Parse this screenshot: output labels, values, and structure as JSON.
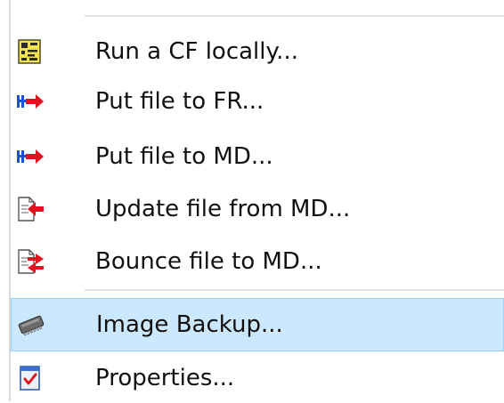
{
  "menu": {
    "items": [
      {
        "label": "Run a CF locally...",
        "icon": "run-cf-icon"
      },
      {
        "label": "Put file to FR...",
        "icon": "put-file-icon"
      },
      {
        "label": "Put file to MD...",
        "icon": "put-file-icon"
      },
      {
        "label": "Update file from MD...",
        "icon": "update-file-icon"
      },
      {
        "label": "Bounce file to MD...",
        "icon": "bounce-file-icon"
      },
      {
        "label": "Image Backup...",
        "icon": "chip-icon",
        "highlighted": true
      },
      {
        "label": "Properties...",
        "icon": "properties-icon"
      }
    ]
  },
  "colors": {
    "highlight_bg": "#cce8ff",
    "highlight_border": "#99d1ff",
    "arrow_red": "#e0141e",
    "arrow_blue": "#1d4fd6"
  }
}
